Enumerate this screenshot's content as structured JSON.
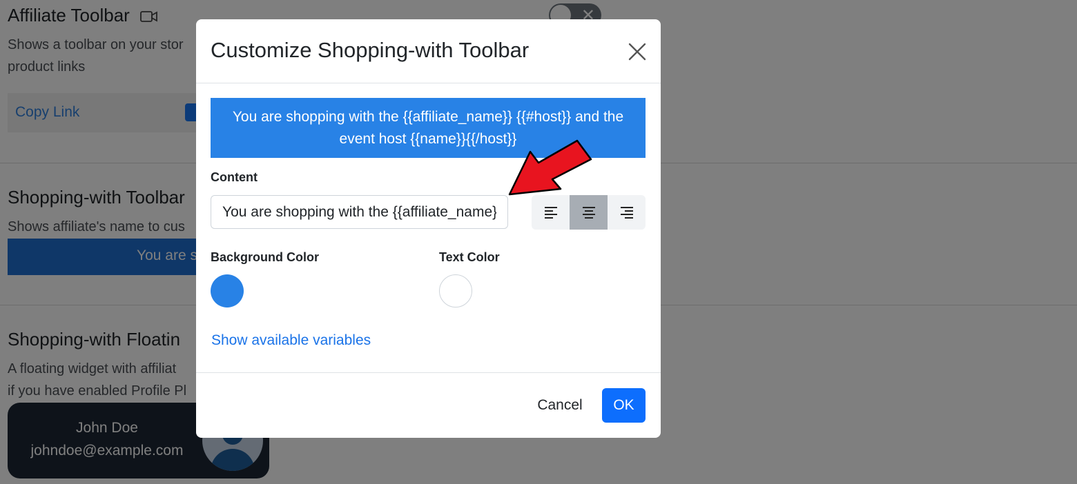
{
  "background_page": {
    "affiliate_toolbar": {
      "title": "Affiliate Toolbar",
      "description": "Shows a toolbar on your stor",
      "description_line2": "product links",
      "copy_link_label": "Copy Link"
    },
    "shopping_toolbar": {
      "title": "Shopping-with Toolbar",
      "description": "Shows affiliate's name to cus",
      "preview_text": "You are s"
    },
    "floating_widget": {
      "title": "Shopping-with Floatin",
      "description_line1": "A floating widget with affiliat",
      "description_line2": "if you have enabled Profile Pl",
      "widget_name": "John Doe",
      "widget_email": "johndoe@example.com"
    }
  },
  "modal": {
    "title": "Customize Shopping-with Toolbar",
    "preview_text": "You are shopping with the {{affiliate_name}} {{#host}} and the event host {{name}}{{/host}}",
    "content_label": "Content",
    "content_value": "You are shopping with the {{affiliate_name}} {{#host}} and the event host {{name}}{{/host}}",
    "alignment_options": [
      "left",
      "center",
      "right"
    ],
    "alignment_selected": "center",
    "background_color_label": "Background Color",
    "background_color": "#2882e6",
    "text_color_label": "Text Color",
    "text_color": "#ffffff",
    "variables_link": "Show available variables",
    "cancel_label": "Cancel",
    "ok_label": "OK"
  },
  "colors": {
    "primary": "#0d6efd",
    "link": "#1a73e8",
    "overlay": "rgba(0,0,0,0.5)",
    "annotation_arrow": "#e8141f"
  },
  "icons": [
    "video-camera-icon",
    "facebook-icon",
    "toggle-switch",
    "close-icon",
    "align-left-icon",
    "align-center-icon",
    "align-right-icon",
    "avatar-icon",
    "annotation-arrow"
  ]
}
